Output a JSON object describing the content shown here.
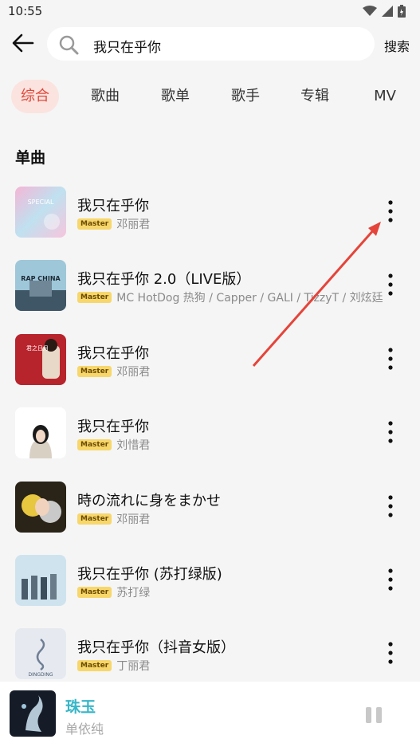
{
  "status": {
    "time": "10:55"
  },
  "search": {
    "query": "我只在乎你",
    "button": "搜索"
  },
  "tabs": [
    {
      "label": "综合",
      "active": true
    },
    {
      "label": "歌曲",
      "active": false
    },
    {
      "label": "歌单",
      "active": false
    },
    {
      "label": "歌手",
      "active": false
    },
    {
      "label": "专辑",
      "active": false
    },
    {
      "label": "MV",
      "active": false
    }
  ],
  "section": {
    "title": "单曲"
  },
  "songs": [
    {
      "title": "我只在乎你",
      "badge": "Master",
      "artist": "邓丽君"
    },
    {
      "title": "我只在乎你 2.0（LIVE版）",
      "badge": "Master",
      "artist": "MC HotDog 热狗 / Capper / GALI / TizzyT / 刘炫廷"
    },
    {
      "title": "我只在乎你",
      "badge": "Master",
      "artist": "邓丽君"
    },
    {
      "title": "我只在乎你",
      "badge": "Master",
      "artist": "刘惜君"
    },
    {
      "title": "時の流れに身をまかせ",
      "badge": "Master",
      "artist": "邓丽君"
    },
    {
      "title": "我只在乎你 (苏打绿版)",
      "badge": "Master",
      "artist": "苏打绿"
    },
    {
      "title": "我只在乎你（抖音女版）",
      "badge": "Master",
      "artist": "丁丽君"
    }
  ],
  "covers": {
    "c0_text": "SPECIAL",
    "c1_text": "RAP CHINA",
    "c2_text": "君之日月",
    "c6_text": "DINGDING"
  },
  "player": {
    "title": "珠玉",
    "artist": "单依纯"
  },
  "colors": {
    "accent": "#e0483a",
    "annotation_arrow": "#e5443a",
    "player_title": "#36b6c8"
  }
}
